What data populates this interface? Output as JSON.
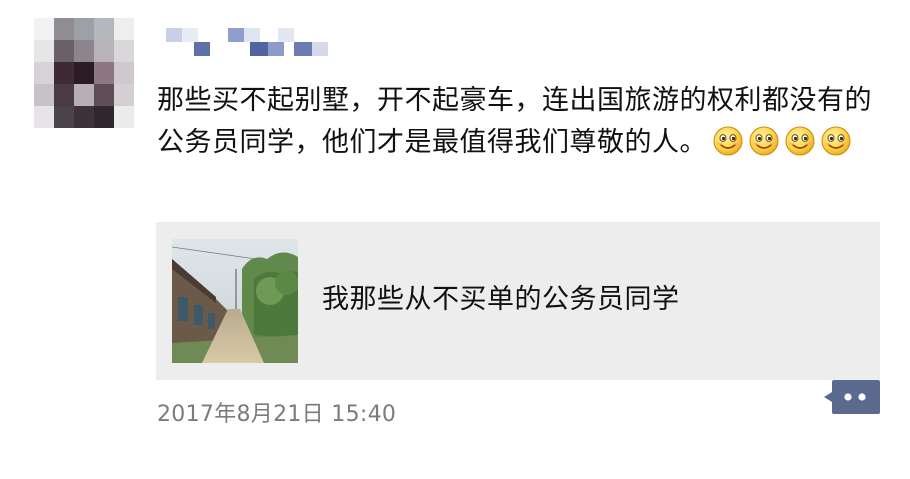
{
  "post": {
    "author_name_pixelated": "",
    "text": "那些买不起别墅，开不起豪车，连出国旅游的权利都没有的公务员同学，他们才是最值得我们尊敬的人。",
    "emojis": [
      "smile-emoji",
      "smile-emoji",
      "smile-emoji",
      "smile-emoji"
    ],
    "link_card": {
      "title": "我那些从不买单的公务员同学",
      "thumbnail": "rural-road-photo"
    },
    "timestamp": "2017年8月21日 15:40",
    "comment_icon": "more-dots-icon"
  },
  "colors": {
    "card_background": "#ededed",
    "timestamp_gray": "#7b7b7b",
    "comment_button_blue": "#5b6b8f"
  }
}
